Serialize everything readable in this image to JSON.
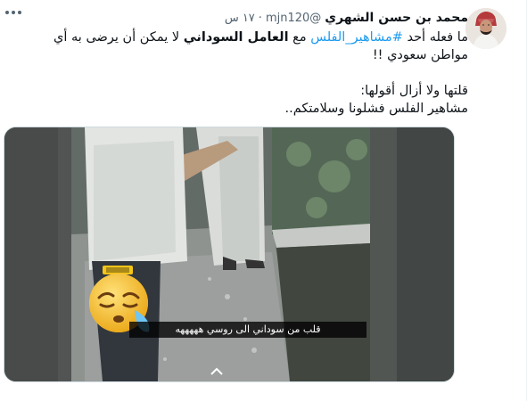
{
  "tweet": {
    "author_name": "محمد بن حسن الشهري",
    "handle": "@mjn120",
    "dot": "·",
    "time": "١٧ س",
    "text": {
      "line1_prefix": "ما فعله أحد ",
      "hashtag": "#مشاهير_الفلس",
      "line1_mid": " مع ",
      "bold_phrase": "العامل السوداني",
      "line1_suffix": " لا يمكن أن يرضى به أي مواطن سعودي !!",
      "line2": "قلتها ولا أزال أقولها:",
      "line3": "مشاهير الفلس فشلونا وسلامتكم.."
    }
  },
  "media": {
    "caption": "قلب من سوداني الى روسي هههههه",
    "sticker_icon": "sleepy-face-emoji-icon",
    "colors": {
      "caption_bg": "#000000",
      "hashtag": "#1d9bf0"
    }
  },
  "icons": {
    "more": "more-options-icon",
    "avatar": "user-avatar",
    "video_chevron": "chevron-up-icon"
  }
}
